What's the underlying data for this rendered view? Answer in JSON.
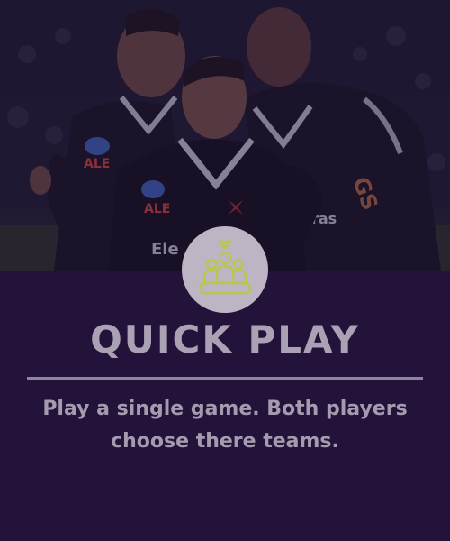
{
  "card": {
    "title": "QUICK PLAY",
    "description": "Play a single game. Both players choose there teams.",
    "icon": "group-of-players-icon"
  },
  "photo": {
    "subject": "team-celebration-photo",
    "jersey_text": [
      "ALE",
      "ALE",
      "Ele",
      "oras",
      "GS"
    ]
  },
  "colors": {
    "background": "#23133b",
    "title": "#aaa1b4",
    "divider": "#8f8599",
    "badge": "#bdb5c3",
    "icon": "#b9c74a"
  }
}
